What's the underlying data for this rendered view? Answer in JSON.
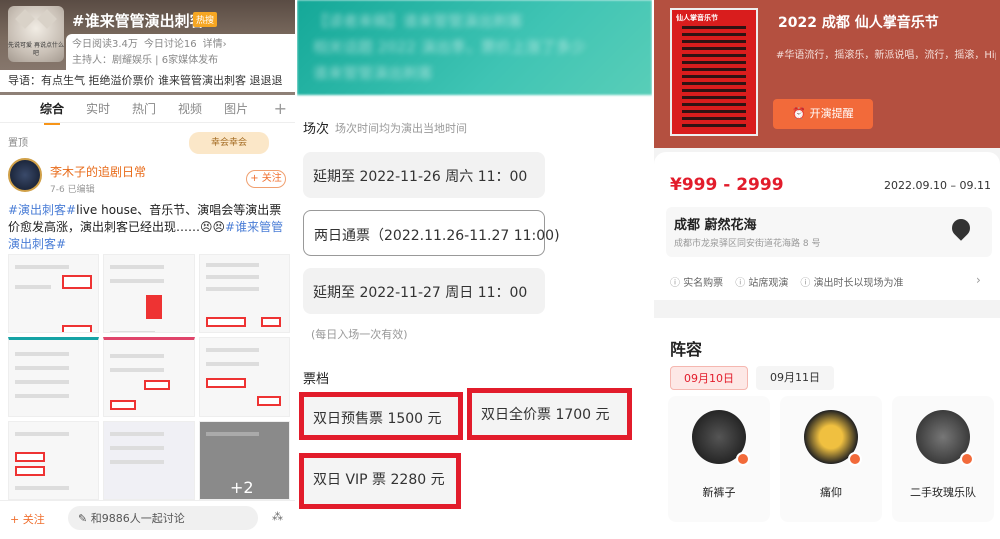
{
  "panel1": {
    "topic_title": "#谁来管管演出刺客#",
    "hot_badge": "热搜",
    "avatar_caption": "先说可爱 再说点什么吧",
    "stats": {
      "reads": "今日阅读3.4万",
      "discuss": "今日讨论16",
      "detail": "详情›"
    },
    "host": "主持人：剧耀娱乐 | 6家媒体发布",
    "guide": "导语：有点生气 拒绝溢价票价 谁来管管演出刺客 退退退",
    "tabs": [
      "综合",
      "实时",
      "热门",
      "视频",
      "图片"
    ],
    "tab_plus": "+",
    "pinned": "置顶",
    "sticker": "幸会幸会",
    "post": {
      "author": "李木子的追剧日常",
      "date": "7-6",
      "edited": "已编辑",
      "follow": "+ 关注",
      "text_hash1": "#演出刺客#",
      "text_body": "live house、音乐节、演唱会等演出票价愈发高涨，演出刺客已经出现……😣😣",
      "text_hash2": "#谁来管管演出刺客#",
      "more_images": "+2"
    },
    "bottom": {
      "follow": "+ 关注",
      "discuss": "和9886人一起讨论",
      "share_icon": "share-icon"
    }
  },
  "panel2": {
    "blur_lines": [
      "【读者来稿】谁来管管演出刺客",
      "相关话题 2022 演出季，票价上涨了多少",
      "谁来管管演出刺客"
    ],
    "session_label": "场次",
    "session_note": "场次时间均为演出当地时间",
    "sessions": [
      "延期至 2022-11-26 周六 11：00",
      "两日通票（2022.11.26-11.27 11:00)",
      "延期至 2022-11-27 周日 11：00"
    ],
    "once_note": "(每日入场一次有效)",
    "tier_label": "票档",
    "tiers": [
      "双日预售票 1500 元",
      "双日全价票 1700 元",
      "双日 VIP 票 2280 元"
    ],
    "highlight_color": "#e21c2b"
  },
  "panel3": {
    "poster_text": "仙人掌音乐节",
    "title": "2022 成都 仙人掌音乐节",
    "tags": "#华语流行，摇滚乐，新派说唱，流行，摇滚，HipH…",
    "remind_btn": "开演提醒",
    "price": "¥999 - 2999",
    "dates": "2022.09.10 – 09.11",
    "venue": "成都 蔚然花海",
    "address": "成都市龙泉驿区同安街道花海路 8 号",
    "notes": [
      "实名购票",
      "站席观演",
      "演出时长以现场为准"
    ],
    "notes_arrow": "›",
    "lineup_title": "阵容",
    "date_tabs": [
      "09月10日",
      "09月11日"
    ],
    "artists": [
      "新裤子",
      "痛仰",
      "二手玫瑰乐队"
    ]
  }
}
